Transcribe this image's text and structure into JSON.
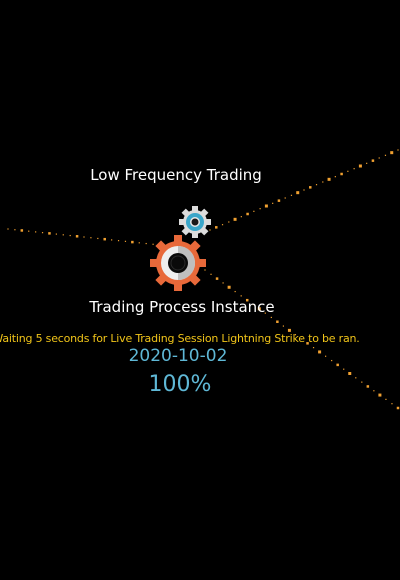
{
  "header": {
    "title": "Low Frequency Trading"
  },
  "process": {
    "subtitle": "Trading Process Instance",
    "status_message": "Waiting 5 seconds for Live Trading Session Lightning Strike to be ran.",
    "date": "2020-10-02",
    "progress_text": "100%",
    "progress_value": 1.0
  },
  "colors": {
    "background": "#000000",
    "title_text": "#ffffff",
    "status_text": "#f0c419",
    "accent_blue": "#5fb8d6",
    "gear_orange": "#e8693a",
    "gear_blue": "#3aa6c9",
    "dot_orange": "#f0a030"
  },
  "icons": {
    "large_gear": "gear-icon",
    "small_gear": "gear-icon"
  }
}
